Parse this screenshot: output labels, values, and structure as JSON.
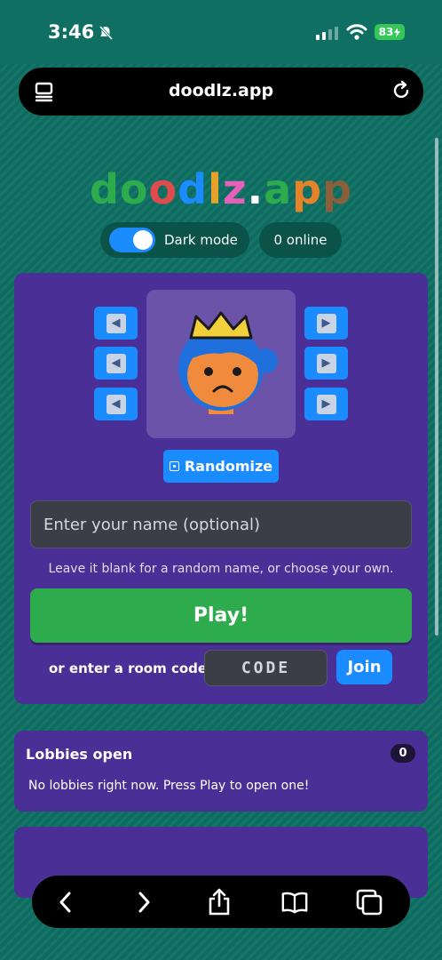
{
  "status": {
    "time": "3:46",
    "battery": "83"
  },
  "browser": {
    "url": "doodlz.app"
  },
  "header": {
    "logo_letters": [
      {
        "ch": "d",
        "color": "#2eab4c"
      },
      {
        "ch": "o",
        "color": "#2eab4c"
      },
      {
        "ch": "o",
        "color": "#e24b4b"
      },
      {
        "ch": "d",
        "color": "#1a8cff"
      },
      {
        "ch": "l",
        "color": "#e5a32a"
      },
      {
        "ch": "z",
        "color": "#e65fb8"
      },
      {
        "ch": ".",
        "color": "#ffffff"
      },
      {
        "ch": "a",
        "color": "#2eab4c"
      },
      {
        "ch": "p",
        "color": "#e5822a"
      },
      {
        "ch": "p",
        "color": "#8a5f3a"
      }
    ],
    "dark_mode_label": "Dark mode",
    "online_label": "0 online"
  },
  "avatar_editor": {
    "randomize_label": "Randomize"
  },
  "form": {
    "name_placeholder": "Enter your name (optional)",
    "hint": "Leave it blank for a random name, or choose your own.",
    "play_label": "Play!",
    "room_code_label": "or enter a room code",
    "code_placeholder": "CODE",
    "join_label": "Join"
  },
  "lobbies": {
    "title": "Lobbies open",
    "count": "0",
    "empty_text": "No lobbies right now. Press Play to open one!"
  },
  "colors": {
    "background": "#0f6f63",
    "card": "#4a2f96",
    "accent_blue": "#1a8cff",
    "play_green": "#2eab4c"
  }
}
